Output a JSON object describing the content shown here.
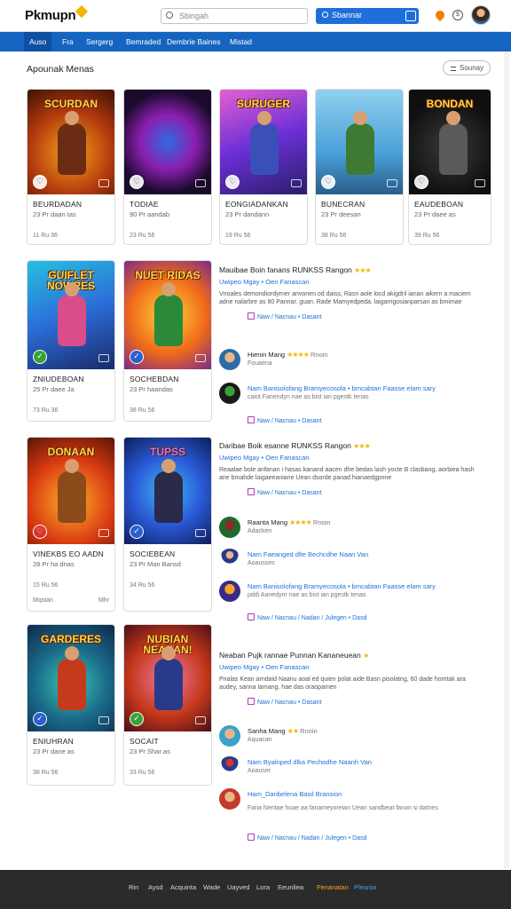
{
  "header": {
    "logo": "Pkmupn",
    "search_placeholder": "Sbingah",
    "search_button_label": "Sbannar"
  },
  "nav": [
    "Auso",
    "Fra",
    "Sergerg",
    "Bemraded",
    "Dembrie Baines",
    "Mistad"
  ],
  "section": {
    "title": "Apounak Menas",
    "sort_label": "Sounay"
  },
  "cards": [
    {
      "art_title": "SCURDAN",
      "name": "BEURDADAN",
      "sub": "23 Pr daan tas",
      "meta": "11 Ru 36"
    },
    {
      "art_title": "",
      "name": "TODIAE",
      "sub": "90 Pr aandab",
      "meta": "23 Ru 56"
    },
    {
      "art_title": "SURUGER",
      "name": "EONGIADANKAN",
      "sub": "23 Pr dandann",
      "meta": "19 Ru 56"
    },
    {
      "art_title": "",
      "name": "BUNECRAN",
      "sub": "23 Pr deesan",
      "meta": "38 Ru 56"
    },
    {
      "art_title": "BONDAN",
      "name": "EAUDEBOAN",
      "sub": "23 Pr daee as",
      "meta": "39 Ru 56"
    },
    {
      "art_title": "GUIFLET NOWRES",
      "name": "ZNIUDEBOAN",
      "sub": "25 Pr daee Ja",
      "meta": "73 Ru 36"
    },
    {
      "art_title": "NUET RIDAS",
      "name": "SOCHEBDAN",
      "sub": "23 Pr haandas",
      "meta": "38 Ru 56"
    },
    {
      "art_title": "DONAAN",
      "name": "VINEKBS EO AADN",
      "sub": "28 Pr ha dnas",
      "meta": "15 Ru 56",
      "foot_left": "Mqstan",
      "foot_right": "Mhr"
    },
    {
      "art_title": "TUPSS",
      "name": "SOCIEBEAN",
      "sub": "23 Pr Man Bansd",
      "meta": "34 Ru 56"
    },
    {
      "art_title": "GARDERES",
      "name": "ENIUHRAN",
      "sub": "23 Pr dane as",
      "meta": "38 Ru 56"
    },
    {
      "art_title": "NUBIAN NEABAN!",
      "name": "SOCAIT",
      "sub": "23 Pr Shar as",
      "meta": "33 Ru 56"
    }
  ],
  "reviews": [
    {
      "title": "Mauibae Boin fanans RUNKSS Rangon",
      "sub": "Uwipeo Mgay • Oen Fanascan",
      "body": "Vnoales demondiordyrner anvonen od daiss, Rasn aole locd akigdnl ianan aikern a maciem adne nalarbre as 80 Pannar. guan. Rade Mamyedpeda. laigamgosianparsan as bmimae",
      "actions": "Naw / Nacnau • Dasant"
    },
    {
      "title": "Daribae Boik esanne RUNKSS Rangon",
      "sub": "Uwipeo Mgay • Oen Fanascan",
      "body": "Reaalae bole anfanan i hasas kanand aacen dhe bedas lash yocte B clasbang, aorbiea hash ane bmahde laigaeeaniane Uean dsorde panad hianaedgpnne",
      "actions": "Naw / Nacnau • Dasant"
    },
    {
      "title": "Neaban Pujk rannae Punnan Kananeuean",
      "sub": "Uwipeo Mgay • Oen Fanascan",
      "body": "Pnalas Kean arndaid Naanu aoal ed quien polat aide Basn pisolatng, 60 dade homtak ara audey, sanna lamang. hae das oraopamen",
      "actions": "Naw / Nacnau • Dasant"
    }
  ],
  "comments": [
    {
      "title": "Hienin Mang",
      "sub": "Fouaena",
      "stars": "★★★★",
      "tail": "Rnoin",
      "link": false
    },
    {
      "title": "Nam Banisolofang Bramyecosola • bmcabtan Faasse elam sary",
      "sub": "caiot Fanendyn nae as bist ian pgestk tenas",
      "actions": "Naw / Nacnau • Dasant",
      "link": true
    },
    {
      "title": "Raanta Mang",
      "sub": "Adacken",
      "stars": "★★★★",
      "tail": "Rnoin",
      "link": false
    },
    {
      "title": "Nam Faeanged dlte Bechcdhe Naan Van",
      "sub": "Aoausses",
      "link": true
    },
    {
      "title": "Nam Banisolofang Bramyecosola • bmcabtan Faasse elam sary",
      "sub": "pddi Aanedynr nae as bist ian pgestk tenas",
      "actions": "Naw / Nacnau / Nadan / Julegen • Dasd",
      "link": true
    },
    {
      "title": "Sanha Mang",
      "sub": "Aquacan",
      "stars": "★★",
      "tail": "Rnoin",
      "link": false
    },
    {
      "title": "Nam Byalnped dlka Pechodhe Naanh Van",
      "sub": "Aoauser",
      "link": true
    },
    {
      "title": "Ham_Danbelena Basil Bransion",
      "sub": "Faria Nentae hoae aa fanameyoreian Uean sandbeat fanon si datnes",
      "actions": "Naw / Nacnau / Nadan / Julegen • Dasd",
      "link": true
    }
  ],
  "footer": [
    "Rin",
    "Aysd",
    "Acquinta",
    "Wade",
    "Uayved",
    "Lora",
    "Eeunliea",
    "Fenanatan",
    "Pleania"
  ],
  "colors": {
    "nav": "#1565c0",
    "accent": "#1e6fd9",
    "star": "#f4b400",
    "footer": "#2b2b2b"
  }
}
